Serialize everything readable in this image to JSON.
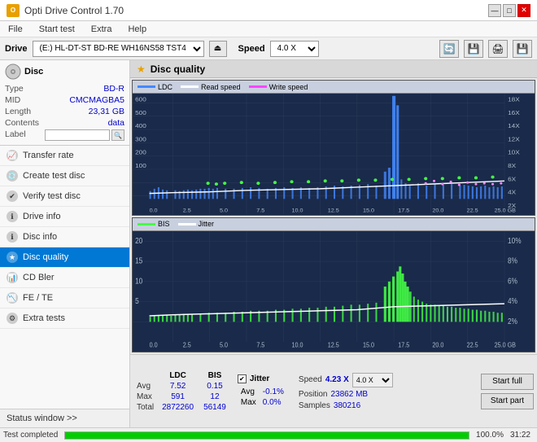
{
  "titleBar": {
    "title": "Opti Drive Control 1.70",
    "controls": [
      "—",
      "□",
      "✕"
    ]
  },
  "menuBar": {
    "items": [
      "File",
      "Start test",
      "Extra",
      "Help"
    ]
  },
  "driveBar": {
    "label": "Drive",
    "driveValue": "(E:)  HL-DT-ST BD-RE  WH16NS58 TST4",
    "speedLabel": "Speed",
    "speedValue": "4.0 X"
  },
  "disc": {
    "title": "Disc",
    "typeLabel": "Type",
    "typeValue": "BD-R",
    "midLabel": "MID",
    "midValue": "CMCMAGBA5",
    "lengthLabel": "Length",
    "lengthValue": "23,31 GB",
    "contentsLabel": "Contents",
    "contentsValue": "data",
    "labelLabel": "Label",
    "labelValue": ""
  },
  "navItems": [
    {
      "id": "transfer-rate",
      "label": "Transfer rate",
      "active": false
    },
    {
      "id": "create-test-disc",
      "label": "Create test disc",
      "active": false
    },
    {
      "id": "verify-test-disc",
      "label": "Verify test disc",
      "active": false
    },
    {
      "id": "drive-info",
      "label": "Drive info",
      "active": false
    },
    {
      "id": "disc-info",
      "label": "Disc info",
      "active": false
    },
    {
      "id": "disc-quality",
      "label": "Disc quality",
      "active": true
    },
    {
      "id": "cd-bler",
      "label": "CD Bler",
      "active": false
    },
    {
      "id": "fe-te",
      "label": "FE / TE",
      "active": false
    },
    {
      "id": "extra-tests",
      "label": "Extra tests",
      "active": false
    }
  ],
  "statusWindow": {
    "label": "Status window >>"
  },
  "discQuality": {
    "title": "Disc quality",
    "chart1": {
      "legend": [
        {
          "label": "LDC",
          "color": "#4488ff"
        },
        {
          "label": "Read speed",
          "color": "#ffffff"
        },
        {
          "label": "Write speed",
          "color": "#ff44ff"
        }
      ],
      "yAxisMax": 600,
      "yAxisRight": [
        "18X",
        "16X",
        "14X",
        "12X",
        "10X",
        "8X",
        "6X",
        "4X",
        "2X"
      ],
      "xAxisLabels": [
        "0.0",
        "2.5",
        "5.0",
        "7.5",
        "10.0",
        "12.5",
        "15.0",
        "17.5",
        "20.0",
        "22.5",
        "25.0 GB"
      ]
    },
    "chart2": {
      "legend": [
        {
          "label": "BIS",
          "color": "#44ff44"
        },
        {
          "label": "Jitter",
          "color": "#ffffff"
        }
      ],
      "yAxisMax": 20,
      "yAxisRight": [
        "10%",
        "8%",
        "6%",
        "4%",
        "2%"
      ],
      "xAxisLabels": [
        "0.0",
        "2.5",
        "5.0",
        "7.5",
        "10.0",
        "12.5",
        "15.0",
        "17.5",
        "20.0",
        "22.5",
        "25.0 GB"
      ]
    }
  },
  "stats": {
    "headers": [
      "",
      "LDC",
      "BIS",
      "",
      "Jitter",
      "Speed"
    ],
    "avgLabel": "Avg",
    "avgLDC": "7.52",
    "avgBIS": "0.15",
    "avgJitter": "-0.1%",
    "maxLabel": "Max",
    "maxLDC": "591",
    "maxBIS": "12",
    "maxJitter": "0.0%",
    "totalLabel": "Total",
    "totalLDC": "2872260",
    "totalBIS": "56149",
    "jitterChecked": true,
    "jitterLabel": "Jitter",
    "speedValue": "4.23 X",
    "speedDropdown": "4.0 X",
    "positionLabel": "Position",
    "positionValue": "23862 MB",
    "samplesLabel": "Samples",
    "samplesValue": "380216",
    "startFullLabel": "Start full",
    "startPartLabel": "Start part"
  },
  "statusBar": {
    "text": "Test completed",
    "progress": 100,
    "percent": "100.0%",
    "time": "31:22"
  }
}
